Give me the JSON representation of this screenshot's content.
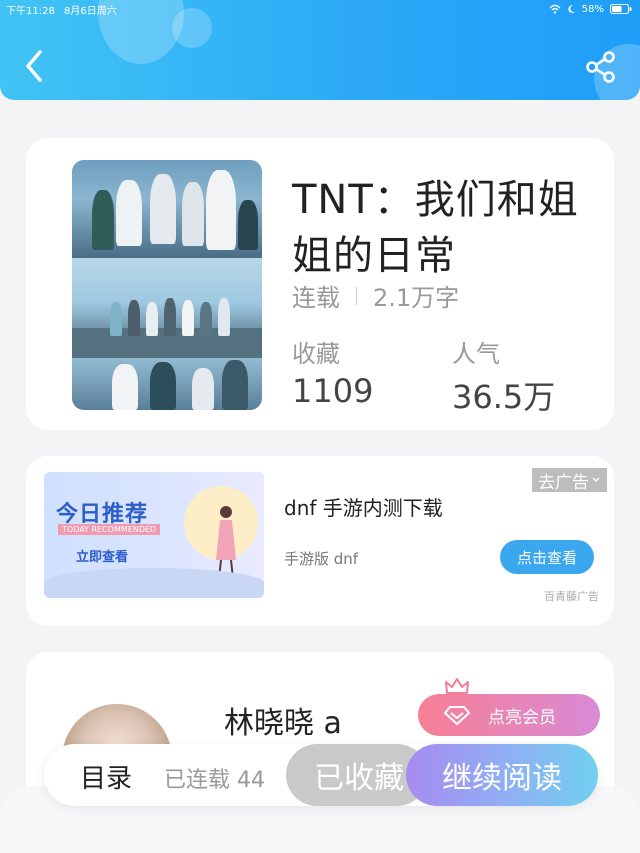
{
  "status_bar": {
    "time": "下午11:28",
    "date": "8月6日周六",
    "battery": "58%"
  },
  "header": {
    "back_icon": "chevron-left-icon",
    "share_icon": "share-icon",
    "color": "#2ba7f7"
  },
  "book": {
    "title": "TNT：我们和姐姐的日常",
    "status": "连载",
    "word_count": "2.1万字",
    "collect_label": "收藏",
    "collect_value": "1109",
    "popularity_label": "人气",
    "popularity_value": "36.5万"
  },
  "ad": {
    "image_title": "今日推荐",
    "image_subtitle": "TODAY RECOMMENDED",
    "image_cta": "立即查看",
    "title": "dnf 手游内测下载",
    "subtitle": "手游版 dnf",
    "button": "点击查看",
    "close_label": "去广告",
    "source": "百青藤广告"
  },
  "author": {
    "name": "林晓晓 a",
    "vip_button": "点亮会员"
  },
  "bottom_bar": {
    "toc": "目录",
    "chapters": "已连载 44",
    "collected": "已收藏",
    "continue": "继续阅读",
    "accent": "#8fb1f4"
  }
}
